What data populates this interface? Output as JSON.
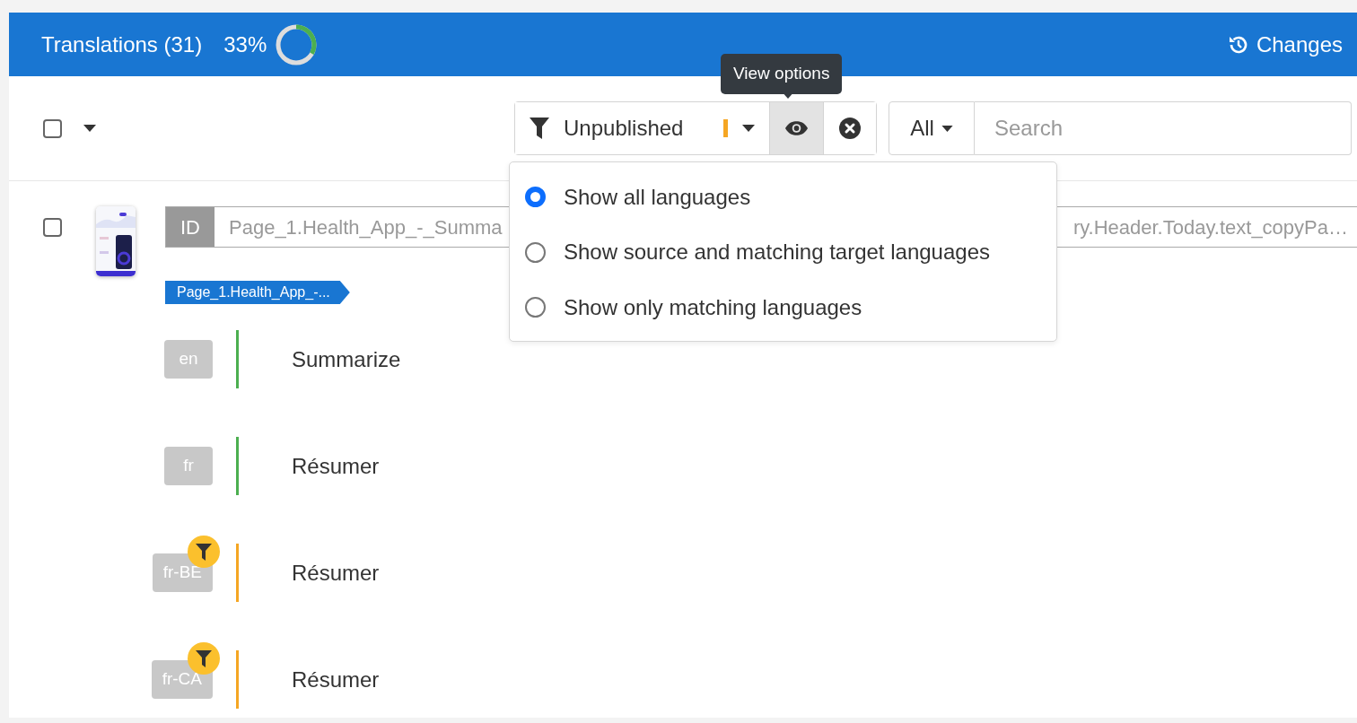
{
  "header": {
    "title": "Translations (31)",
    "percent": "33%",
    "level": 0.33,
    "changes_button": "Changes"
  },
  "toolbar": {
    "select_all": {
      "checked": false
    },
    "filter": {
      "label": "Unpublished",
      "active": true
    },
    "view_options_tooltip": "View options",
    "scope": "All",
    "search": {
      "placeholder": "Search"
    }
  },
  "view_options_menu": [
    {
      "label": "Show all languages",
      "selected": true
    },
    {
      "label": "Show source and matching target languages",
      "selected": false
    },
    {
      "label": "Show only matching languages",
      "selected": false
    }
  ],
  "entry": {
    "checked": false,
    "id_label": "ID",
    "id_value_start": "Page_1.Health_App_-_Summa",
    "id_value_end": "ry.Header.Today.text_copyPa…",
    "tag": "Page_1.Health_App_-...",
    "languages": [
      {
        "code": "en",
        "text": "Summarize",
        "color": "#4caf50",
        "filtered": false
      },
      {
        "code": "fr",
        "text": "Résumer",
        "color": "#4caf50",
        "filtered": false
      },
      {
        "code": "fr-BE",
        "text": "Résumer",
        "color": "#f5a623",
        "filtered": true
      },
      {
        "code": "fr-CA",
        "text": "Résumer",
        "color": "#f5a623",
        "filtered": true
      }
    ]
  }
}
